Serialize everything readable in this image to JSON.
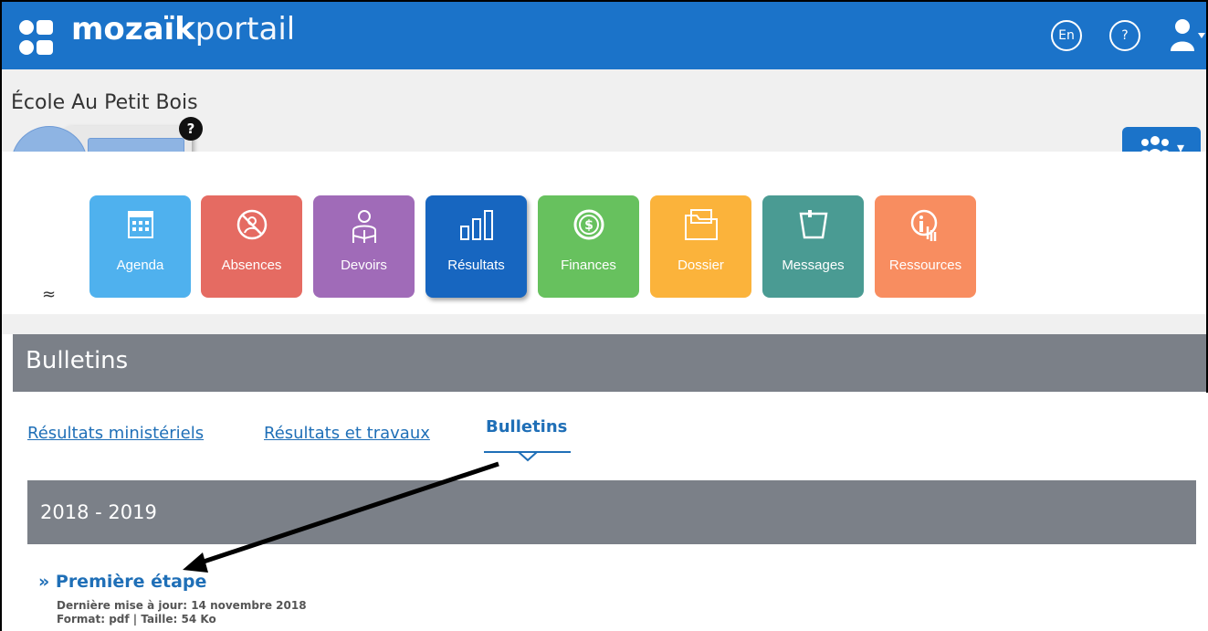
{
  "header": {
    "logo_bold": "mozaïk",
    "logo_light": "portail",
    "lang_button": "En",
    "help_button": "?",
    "brand_color": "#1b73c9"
  },
  "school": {
    "name": "École Au Petit Bois",
    "help_badge": "?"
  },
  "tiles": [
    {
      "label": "Agenda",
      "color": "#4fb1ee",
      "icon": "calendar-icon"
    },
    {
      "label": "Absences",
      "color": "#e56b62",
      "icon": "absence-icon"
    },
    {
      "label": "Devoirs",
      "color": "#a06bb8",
      "icon": "homework-icon"
    },
    {
      "label": "Résultats",
      "color": "#1766c0",
      "icon": "bar-chart-icon"
    },
    {
      "label": "Finances",
      "color": "#67c15e",
      "icon": "dollar-icon"
    },
    {
      "label": "Dossier",
      "color": "#fbb33b",
      "icon": "folder-icon"
    },
    {
      "label": "Messages",
      "color": "#4a9b93",
      "icon": "note-icon"
    },
    {
      "label": "Ressources",
      "color": "#f88d60",
      "icon": "info-hand-icon"
    }
  ],
  "collapse_glyph": "≈",
  "section": {
    "title": "Bulletins"
  },
  "tabs": {
    "ministry": "Résultats ministériels",
    "results": "Résultats et travaux",
    "bulletins": "Bulletins"
  },
  "year": "2018 - 2019",
  "document": {
    "title": "» Première étape",
    "updated": "Dernière mise à jour: 14 novembre 2018",
    "format": "Format: pdf | Taille: 54 Ko"
  },
  "group_caret": "▾"
}
